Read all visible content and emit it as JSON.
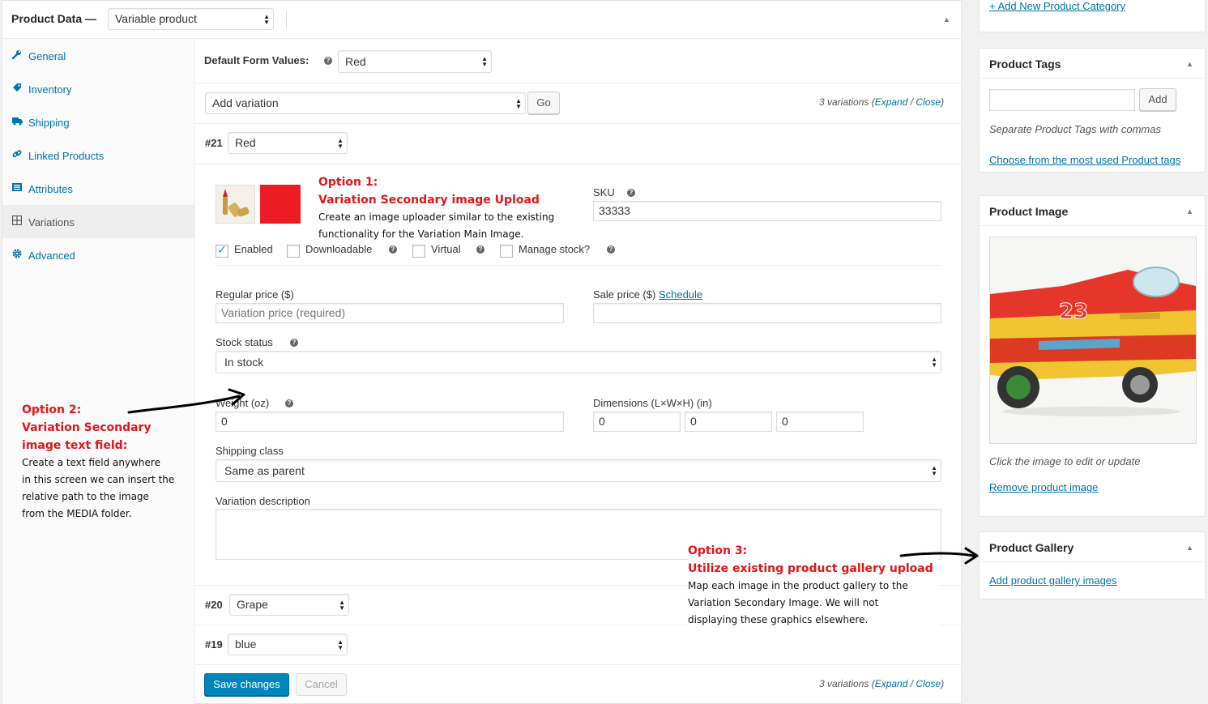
{
  "product_data": {
    "title": "Product Data —",
    "type_select": "Variable product",
    "tabs": [
      {
        "label": "General",
        "icon": "wrench-icon"
      },
      {
        "label": "Inventory",
        "icon": "tag-icon"
      },
      {
        "label": "Shipping",
        "icon": "truck-icon"
      },
      {
        "label": "Linked Products",
        "icon": "link-icon"
      },
      {
        "label": "Attributes",
        "icon": "list-icon"
      },
      {
        "label": "Variations",
        "icon": "grid-icon"
      },
      {
        "label": "Advanced",
        "icon": "gear-icon"
      }
    ],
    "active_tab": "Variations"
  },
  "variations": {
    "default_form_label": "Default Form Values:",
    "default_form_value": "Red",
    "add_select": "Add variation",
    "go_label": "Go",
    "count_text": "3 variations (",
    "expand_label": "Expand",
    "slash": " / ",
    "close_label": "Close",
    "close_paren": ")",
    "items": [
      {
        "id": "#21",
        "value": "Red"
      },
      {
        "id": "#20",
        "value": "Grape"
      },
      {
        "id": "#19",
        "value": "blue"
      }
    ],
    "expanded": {
      "sku_label": "SKU",
      "sku_value": "33333",
      "thumb_color": "#ee1c25",
      "checkboxes": {
        "enabled": "Enabled",
        "downloadable": "Downloadable",
        "virtual": "Virtual",
        "manage_stock": "Manage stock?"
      },
      "regular_price_label": "Regular price ($)",
      "regular_price_placeholder": "Variation price (required)",
      "sale_price_label": "Sale price ($)",
      "schedule_label": "Schedule",
      "stock_status_label": "Stock status",
      "stock_status_value": "In stock",
      "weight_label": "Weight (oz)",
      "weight_value": "0",
      "dimensions_label": "Dimensions (L×W×H) (in)",
      "dim_l": "0",
      "dim_w": "0",
      "dim_h": "0",
      "shipping_class_label": "Shipping class",
      "shipping_class_value": "Same as parent",
      "description_label": "Variation description"
    },
    "save_label": "Save changes",
    "cancel_label": "Cancel"
  },
  "annotations": {
    "opt1_title": "Option 1:",
    "opt1_subtitle": "Variation Secondary image Upload",
    "opt1_line1": "Create an image uploader similar to the existing",
    "opt1_line2": "functionality for the Variation Main Image.",
    "opt2_title1": "Option 2:",
    "opt2_title2": "Variation Secondary",
    "opt2_title3": "image text field:",
    "opt2_line1": "Create a text field anywhere",
    "opt2_line2": "in this screen we can insert the",
    "opt2_line3": "relative path to the image",
    "opt2_line4": "from the MEDIA folder.",
    "opt3_title": "Option 3:",
    "opt3_subtitle": "Utilize existing product gallery upload",
    "opt3_line1": "Map each image in the product gallery to the",
    "opt3_line2": "Variation Secondary Image. We will not",
    "opt3_line3": "displaying these graphics elsewhere."
  },
  "sidebar": {
    "add_category_link": "+ Add New Product Category",
    "tags": {
      "title": "Product Tags",
      "add_label": "Add",
      "hint": "Separate Product Tags with commas",
      "choose_link": "Choose from the most used Product tags"
    },
    "image": {
      "title": "Product Image",
      "hint": "Click the image to edit or update",
      "remove_link": "Remove product image",
      "image_text": "23"
    },
    "gallery": {
      "title": "Product Gallery",
      "add_link": "Add product gallery images"
    }
  }
}
